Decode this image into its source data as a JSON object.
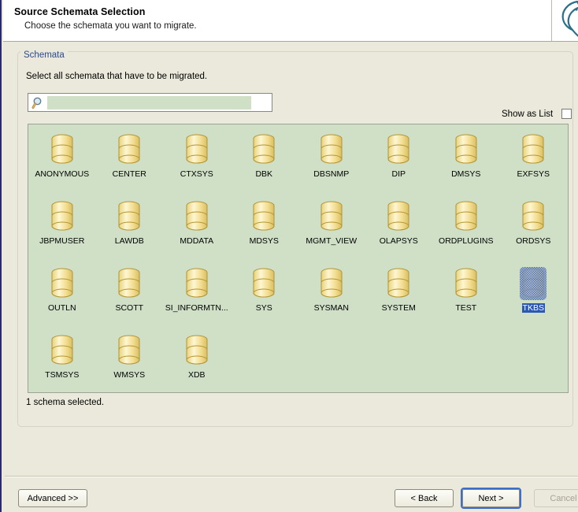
{
  "header": {
    "title": "Source Schemata Selection",
    "subtitle": "Choose the schemata you want to migrate.",
    "logo_icon": "dolphin-logo-icon"
  },
  "groupbox": {
    "legend": "Schemata",
    "instruction": "Select all schemata that have to be migrated."
  },
  "search": {
    "icon": "search-icon",
    "value": "",
    "placeholder": ""
  },
  "show_as_list": {
    "label": "Show as List",
    "checked": false
  },
  "grid": {
    "item_icon": "database-cylinder-icon",
    "rows": [
      [
        {
          "label": "ANONYMOUS",
          "selected": false
        },
        {
          "label": "CENTER",
          "selected": false
        },
        {
          "label": "CTXSYS",
          "selected": false
        },
        {
          "label": "DBK",
          "selected": false
        },
        {
          "label": "DBSNMP",
          "selected": false
        },
        {
          "label": "DIP",
          "selected": false
        },
        {
          "label": "DMSYS",
          "selected": false
        },
        {
          "label": "EXFSYS",
          "selected": false
        }
      ],
      [
        {
          "label": "JBPMUSER",
          "selected": false
        },
        {
          "label": "LAWDB",
          "selected": false
        },
        {
          "label": "MDDATA",
          "selected": false
        },
        {
          "label": "MDSYS",
          "selected": false
        },
        {
          "label": "MGMT_VIEW",
          "selected": false
        },
        {
          "label": "OLAPSYS",
          "selected": false
        },
        {
          "label": "ORDPLUGINS",
          "selected": false
        },
        {
          "label": "ORDSYS",
          "selected": false
        }
      ],
      [
        {
          "label": "OUTLN",
          "selected": false
        },
        {
          "label": "SCOTT",
          "selected": false
        },
        {
          "label": "SI_INFORMTN...",
          "selected": false
        },
        {
          "label": "SYS",
          "selected": false
        },
        {
          "label": "SYSMAN",
          "selected": false
        },
        {
          "label": "SYSTEM",
          "selected": false
        },
        {
          "label": "TEST",
          "selected": false
        },
        {
          "label": "TKBS",
          "selected": true
        }
      ],
      [
        {
          "label": "TSMSYS",
          "selected": false
        },
        {
          "label": "WMSYS",
          "selected": false
        },
        {
          "label": "XDB",
          "selected": false
        }
      ]
    ]
  },
  "status": {
    "text": "1 schema selected."
  },
  "buttons": {
    "advanced": "Advanced >>",
    "back": "< Back",
    "next": "Next >",
    "cancel": "Cancel"
  },
  "colors": {
    "window_bg": "#ebe8dc",
    "panel_green": "#cfe0c7",
    "selection_blue": "#2b57b5",
    "legend_blue": "#2b4b8f",
    "focus_blue": "#3f6fc4",
    "rail_navy": "#2b2b6b"
  }
}
